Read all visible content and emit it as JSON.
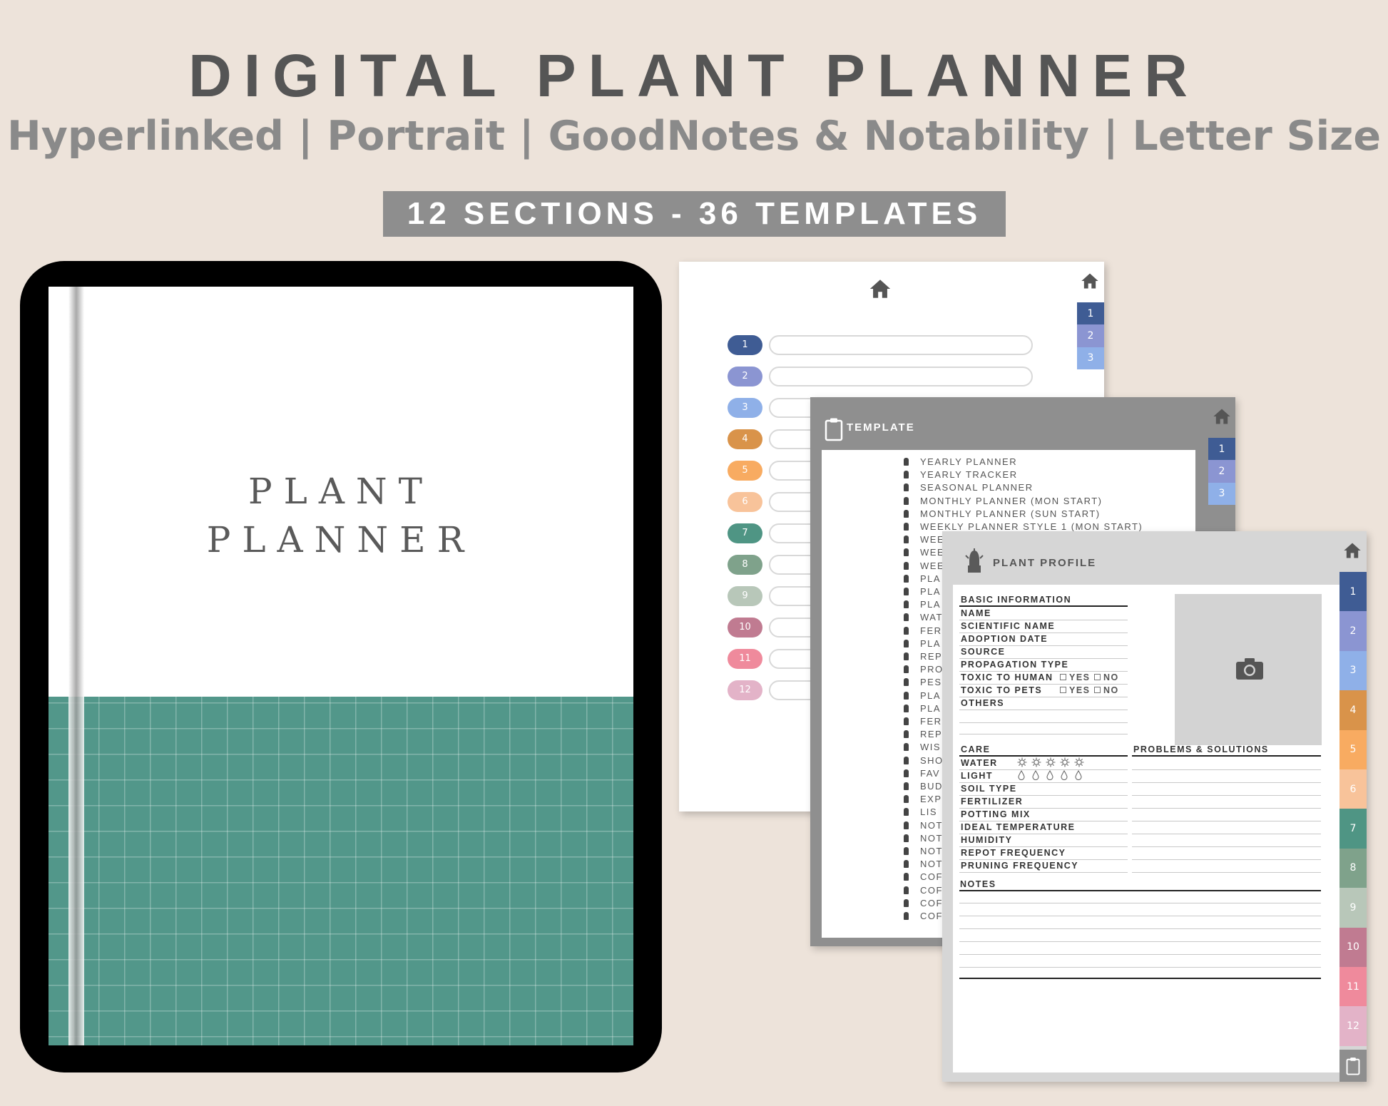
{
  "header": {
    "title": "DIGITAL PLANT PLANNER",
    "subtitle": "Hyperlinked | Portrait | GoodNotes & Notability | Letter Size",
    "badge": "12 SECTIONS - 36 TEMPLATES"
  },
  "cover": {
    "line1": "PLANT",
    "line2": "PLANNER"
  },
  "colors": {
    "sections": [
      "#3f5c94",
      "#8b95d2",
      "#8fb0e8",
      "#d9934a",
      "#f8ab61",
      "#f8c39a",
      "#4f9584",
      "#7fa28b",
      "#b8c7b9",
      "#c07b91",
      "#ef8a9c",
      "#e3b3c8"
    ],
    "cover_grid": "#52978a",
    "template_header": "#8f8f8f",
    "profile_header": "#d6d6d6"
  },
  "index_page": {
    "home_icon": "home-icon",
    "sections": [
      "1",
      "2",
      "3",
      "4",
      "5",
      "6",
      "7",
      "8",
      "9",
      "10",
      "11",
      "12"
    ],
    "tabs": [
      "1",
      "2",
      "3"
    ]
  },
  "template_page": {
    "header": "TEMPLATE",
    "header_icon": "clipboard-icon",
    "tabs": [
      "1",
      "2",
      "3"
    ],
    "items": [
      "YEARLY PLANNER",
      "YEARLY TRACKER",
      "SEASONAL PLANNER",
      "MONTHLY PLANNER (MON START)",
      "MONTHLY PLANNER (SUN START)",
      "WEEKLY PLANNER STYLE 1 (MON START)",
      "WEE",
      "WEE",
      "WEE",
      "PLA",
      "PLA",
      "PLA",
      "WAT",
      "FER",
      "PLA",
      "REP",
      "PRO",
      "PES",
      "PLA",
      "PLA",
      "FER",
      "REP",
      "WIS",
      "SHO",
      "FAV",
      "BUD",
      "EXP",
      "LIS",
      "NOT",
      "NOT",
      "NOT",
      "NOT",
      "COF",
      "COF",
      "COF",
      "COF"
    ]
  },
  "profile_page": {
    "header": "PLANT PROFILE",
    "header_icon": "cactus-icon",
    "tabs": [
      "1",
      "2",
      "3",
      "4",
      "5",
      "6",
      "7",
      "8",
      "9",
      "10",
      "11",
      "12"
    ],
    "basic_info": {
      "heading": "BASIC INFORMATION",
      "fields": [
        "NAME",
        "SCIENTIFIC NAME",
        "ADOPTION DATE",
        "SOURCE",
        "PROPAGATION TYPE",
        "TOXIC TO HUMAN",
        "TOXIC TO PETS",
        "OTHERS"
      ],
      "yes": "YES",
      "no": "NO"
    },
    "photo_icon": "camera-icon",
    "care": {
      "heading": "CARE",
      "fields": [
        "WATER",
        "LIGHT",
        "SOIL TYPE",
        "FERTILIZER",
        "POTTING MIX",
        "IDEAL TEMPERATURE",
        "HUMIDITY",
        "REPOT FREQUENCY",
        "PRUNING FREQUENCY"
      ]
    },
    "problems_heading": "PROBLEMS & SOLUTIONS",
    "notes_heading": "NOTES",
    "bottom_icon": "clipboard-icon"
  }
}
